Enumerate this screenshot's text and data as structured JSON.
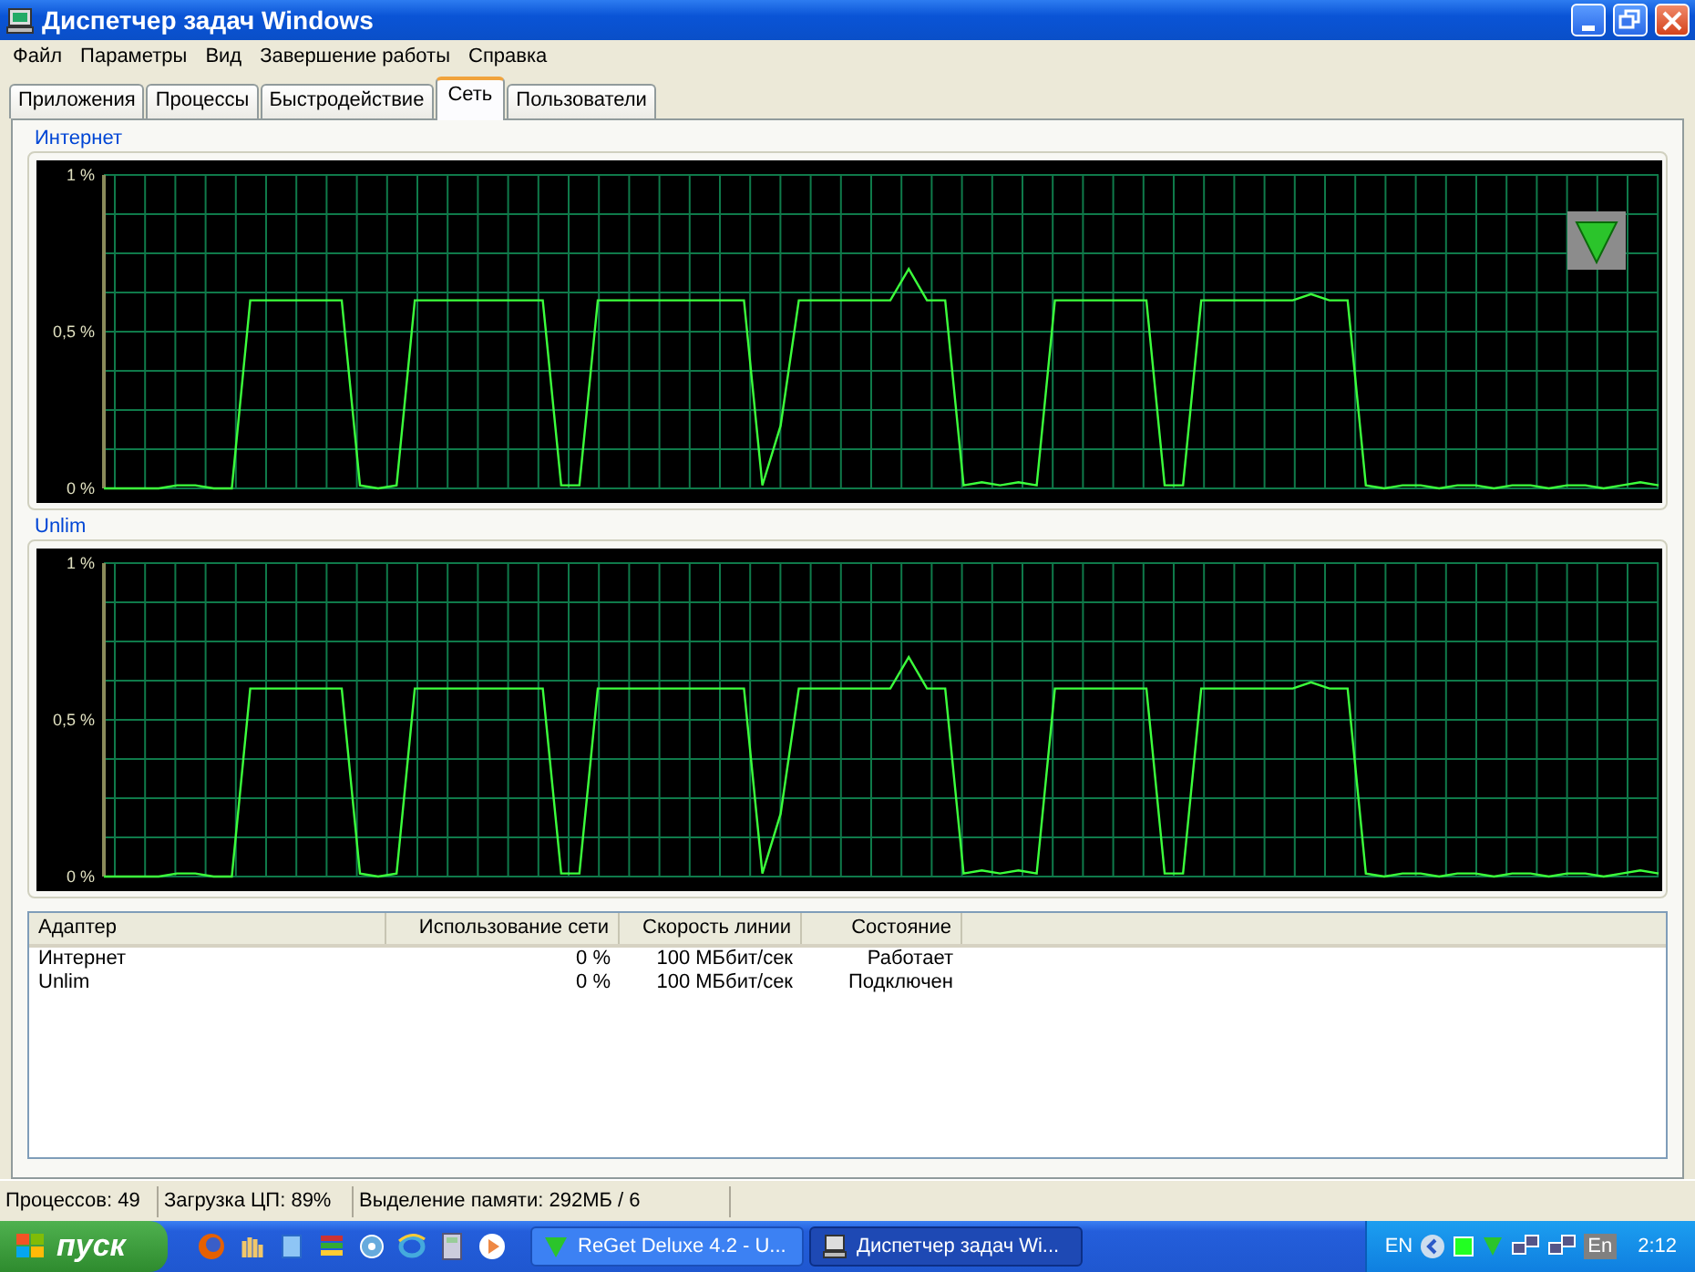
{
  "window": {
    "title": "Диспетчер задач Windows"
  },
  "menu": [
    "Файл",
    "Параметры",
    "Вид",
    "Завершение работы",
    "Справка"
  ],
  "tabs": [
    {
      "label": "Приложения",
      "selected": false
    },
    {
      "label": "Процессы",
      "selected": false
    },
    {
      "label": "Быстродействие",
      "selected": false
    },
    {
      "label": "Сеть",
      "selected": true
    },
    {
      "label": "Пользователи",
      "selected": false
    }
  ],
  "graphs": [
    {
      "title": "Интернет",
      "chart_data": {
        "type": "line",
        "ylim": [
          0,
          1
        ],
        "yticks": [
          {
            "value": 0,
            "label": "0 %"
          },
          {
            "value": 0.5,
            "label": "0,5 %"
          },
          {
            "value": 1,
            "label": "1 %"
          }
        ],
        "grid": true,
        "series": [
          {
            "color": "#3cff3c",
            "values": [
              0,
              0,
              0,
              0,
              0.01,
              0.01,
              0,
              0,
              0.6,
              0.6,
              0.6,
              0.6,
              0.6,
              0.6,
              0.01,
              0,
              0.01,
              0.6,
              0.6,
              0.6,
              0.6,
              0.6,
              0.6,
              0.6,
              0.6,
              0.01,
              0.01,
              0.6,
              0.6,
              0.6,
              0.6,
              0.6,
              0.6,
              0.6,
              0.6,
              0.6,
              0.01,
              0.2,
              0.6,
              0.6,
              0.6,
              0.6,
              0.6,
              0.6,
              0.7,
              0.6,
              0.6,
              0.01,
              0.02,
              0.01,
              0.02,
              0.01,
              0.6,
              0.6,
              0.6,
              0.6,
              0.6,
              0.6,
              0.01,
              0.01,
              0.6,
              0.6,
              0.6,
              0.6,
              0.6,
              0.6,
              0.62,
              0.6,
              0.6,
              0.01,
              0,
              0.01,
              0.01,
              0,
              0.01,
              0.01,
              0,
              0.01,
              0.01,
              0,
              0.01,
              0.01,
              0,
              0.01,
              0.02,
              0.01
            ]
          }
        ]
      }
    },
    {
      "title": "Unlim",
      "chart_data": {
        "type": "line",
        "ylim": [
          0,
          1
        ],
        "yticks": [
          {
            "value": 0,
            "label": "0 %"
          },
          {
            "value": 0.5,
            "label": "0,5 %"
          },
          {
            "value": 1,
            "label": "1 %"
          }
        ],
        "grid": true,
        "series": [
          {
            "color": "#3cff3c",
            "values": [
              0,
              0,
              0,
              0,
              0.01,
              0.01,
              0,
              0,
              0.6,
              0.6,
              0.6,
              0.6,
              0.6,
              0.6,
              0.01,
              0,
              0.01,
              0.6,
              0.6,
              0.6,
              0.6,
              0.6,
              0.6,
              0.6,
              0.6,
              0.01,
              0.01,
              0.6,
              0.6,
              0.6,
              0.6,
              0.6,
              0.6,
              0.6,
              0.6,
              0.6,
              0.01,
              0.2,
              0.6,
              0.6,
              0.6,
              0.6,
              0.6,
              0.6,
              0.7,
              0.6,
              0.6,
              0.01,
              0.02,
              0.01,
              0.02,
              0.01,
              0.6,
              0.6,
              0.6,
              0.6,
              0.6,
              0.6,
              0.01,
              0.01,
              0.6,
              0.6,
              0.6,
              0.6,
              0.6,
              0.6,
              0.62,
              0.6,
              0.6,
              0.01,
              0,
              0.01,
              0.01,
              0,
              0.01,
              0.01,
              0,
              0.01,
              0.01,
              0,
              0.01,
              0.01,
              0,
              0.01,
              0.02,
              0.01
            ]
          }
        ]
      }
    }
  ],
  "table": {
    "columns": [
      "Адаптер",
      "Использование сети",
      "Скорость линии",
      "Состояние"
    ],
    "rows": [
      [
        "Интернет",
        "0 %",
        "100 МБбит/сек",
        "Работает"
      ],
      [
        "Unlim",
        "0 %",
        "100 МБбит/сек",
        "Подключен"
      ]
    ]
  },
  "status_bar": [
    "Процессов: 49",
    "Загрузка ЦП: 89%",
    "Выделение памяти: 292МБ / 6"
  ],
  "taskbar": {
    "start": "пуск",
    "tasks": [
      {
        "label": "ReGet Deluxe 4.2 - U...",
        "selected": false
      },
      {
        "label": "Диспетчер задач Wi...",
        "selected": true
      }
    ],
    "language": "EN",
    "keyboard": "En",
    "clock": "2:12"
  }
}
